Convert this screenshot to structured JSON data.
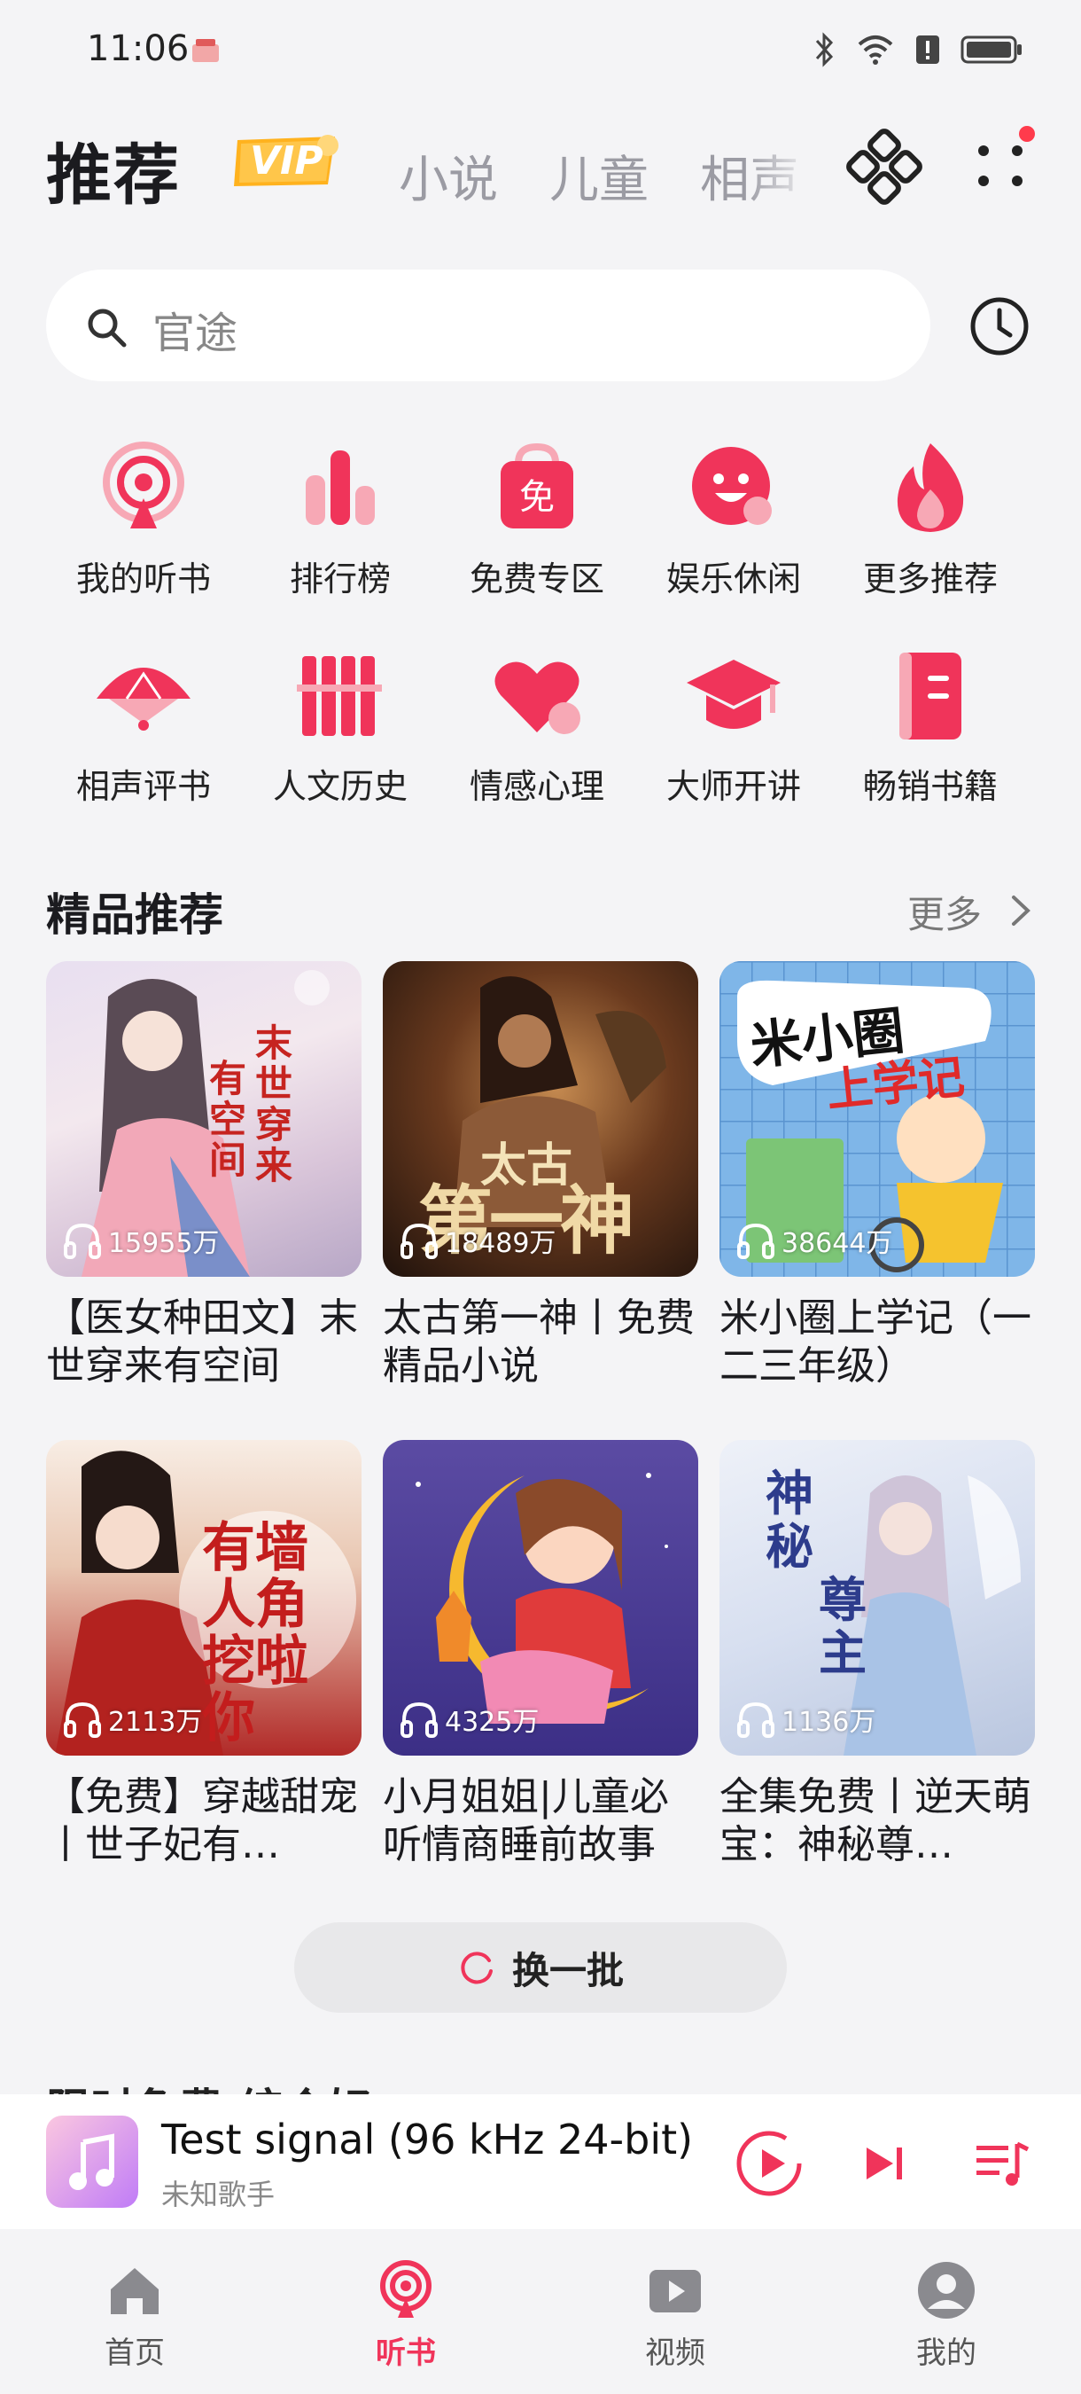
{
  "status_bar": {
    "time": "11:06"
  },
  "header": {
    "title": "推荐",
    "vip_badge": "VIP",
    "tabs": [
      "小说",
      "儿童",
      "相声"
    ]
  },
  "search": {
    "placeholder": "官途"
  },
  "categories": [
    {
      "label": "我的听书",
      "icon": "podcast-icon"
    },
    {
      "label": "排行榜",
      "icon": "ranking-bars-icon"
    },
    {
      "label": "免费专区",
      "icon": "free-bag-icon"
    },
    {
      "label": "娱乐休闲",
      "icon": "smile-icon"
    },
    {
      "label": "更多推荐",
      "icon": "flame-icon"
    },
    {
      "label": "相声评书",
      "icon": "fan-icon"
    },
    {
      "label": "人文历史",
      "icon": "bamboo-scroll-icon"
    },
    {
      "label": "情感心理",
      "icon": "heart-icon"
    },
    {
      "label": "大师开讲",
      "icon": "graduation-cap-icon"
    },
    {
      "label": "畅销书籍",
      "icon": "book-icon"
    }
  ],
  "section": {
    "title": "精品推荐",
    "more": "更多"
  },
  "books": [
    {
      "title": "【医女种田文】末世穿来有空间",
      "plays": "15955万",
      "cover_text": "末世穿来有空间"
    },
    {
      "title": "太古第一神丨免费精品小说",
      "plays": "18489万",
      "cover_text": "太古第一神"
    },
    {
      "title": "米小圈上学记（一二三年级）",
      "plays": "38644万",
      "cover_text": "米小圈上学记"
    },
    {
      "title": "【免费】穿越甜宠丨世子妃有…",
      "plays": "2113万",
      "cover_text": "墙角有人挖你"
    },
    {
      "title": "小月姐姐|儿童必听情商睡前故事",
      "plays": "4325万",
      "cover_text": ""
    },
    {
      "title": "全集免费丨逆天萌宝：神秘尊…",
      "plays": "1136万",
      "cover_text": "神秘尊主"
    }
  ],
  "refresh_label": "换一批",
  "next_section_title": "限时免费 综合好",
  "player": {
    "title": "Test signal (96 kHz 24-bit)",
    "artist": "未知歌手"
  },
  "bottom_nav": [
    {
      "label": "首页",
      "active": false
    },
    {
      "label": "听书",
      "active": true
    },
    {
      "label": "视频",
      "active": false
    },
    {
      "label": "我的",
      "active": false
    }
  ],
  "colors": {
    "accent": "#f0345a",
    "vip": "#ffb21e",
    "background": "#f4f4f6"
  }
}
